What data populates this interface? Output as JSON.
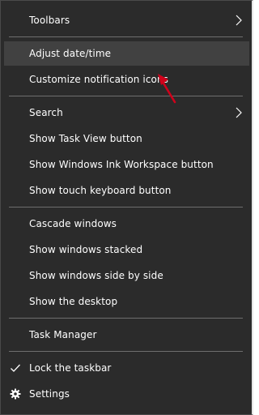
{
  "menu": {
    "toolbars": "Toolbars",
    "adjust_datetime": "Adjust date/time",
    "customize_notification": "Customize notification icons",
    "search": "Search",
    "show_task_view": "Show Task View button",
    "show_ink_workspace": "Show Windows Ink Workspace button",
    "show_touch_keyboard": "Show touch keyboard button",
    "cascade": "Cascade windows",
    "stacked": "Show windows stacked",
    "side_by_side": "Show windows side by side",
    "show_desktop": "Show the desktop",
    "task_manager": "Task Manager",
    "lock_taskbar": "Lock the taskbar",
    "settings": "Settings"
  },
  "state": {
    "hovered_item": "Adjust date/time",
    "lock_taskbar_checked": true
  },
  "icons": {
    "submenu": "chevron-right-icon",
    "check": "checkmark-icon",
    "settings": "gear-icon",
    "annotation": "red-arrow-icon"
  },
  "colors": {
    "menu_bg": "#2b2b2b",
    "hover_bg": "#414141",
    "separator": "#6e6e6e",
    "text": "#ffffff",
    "annotation_arrow": "#d0021b"
  }
}
